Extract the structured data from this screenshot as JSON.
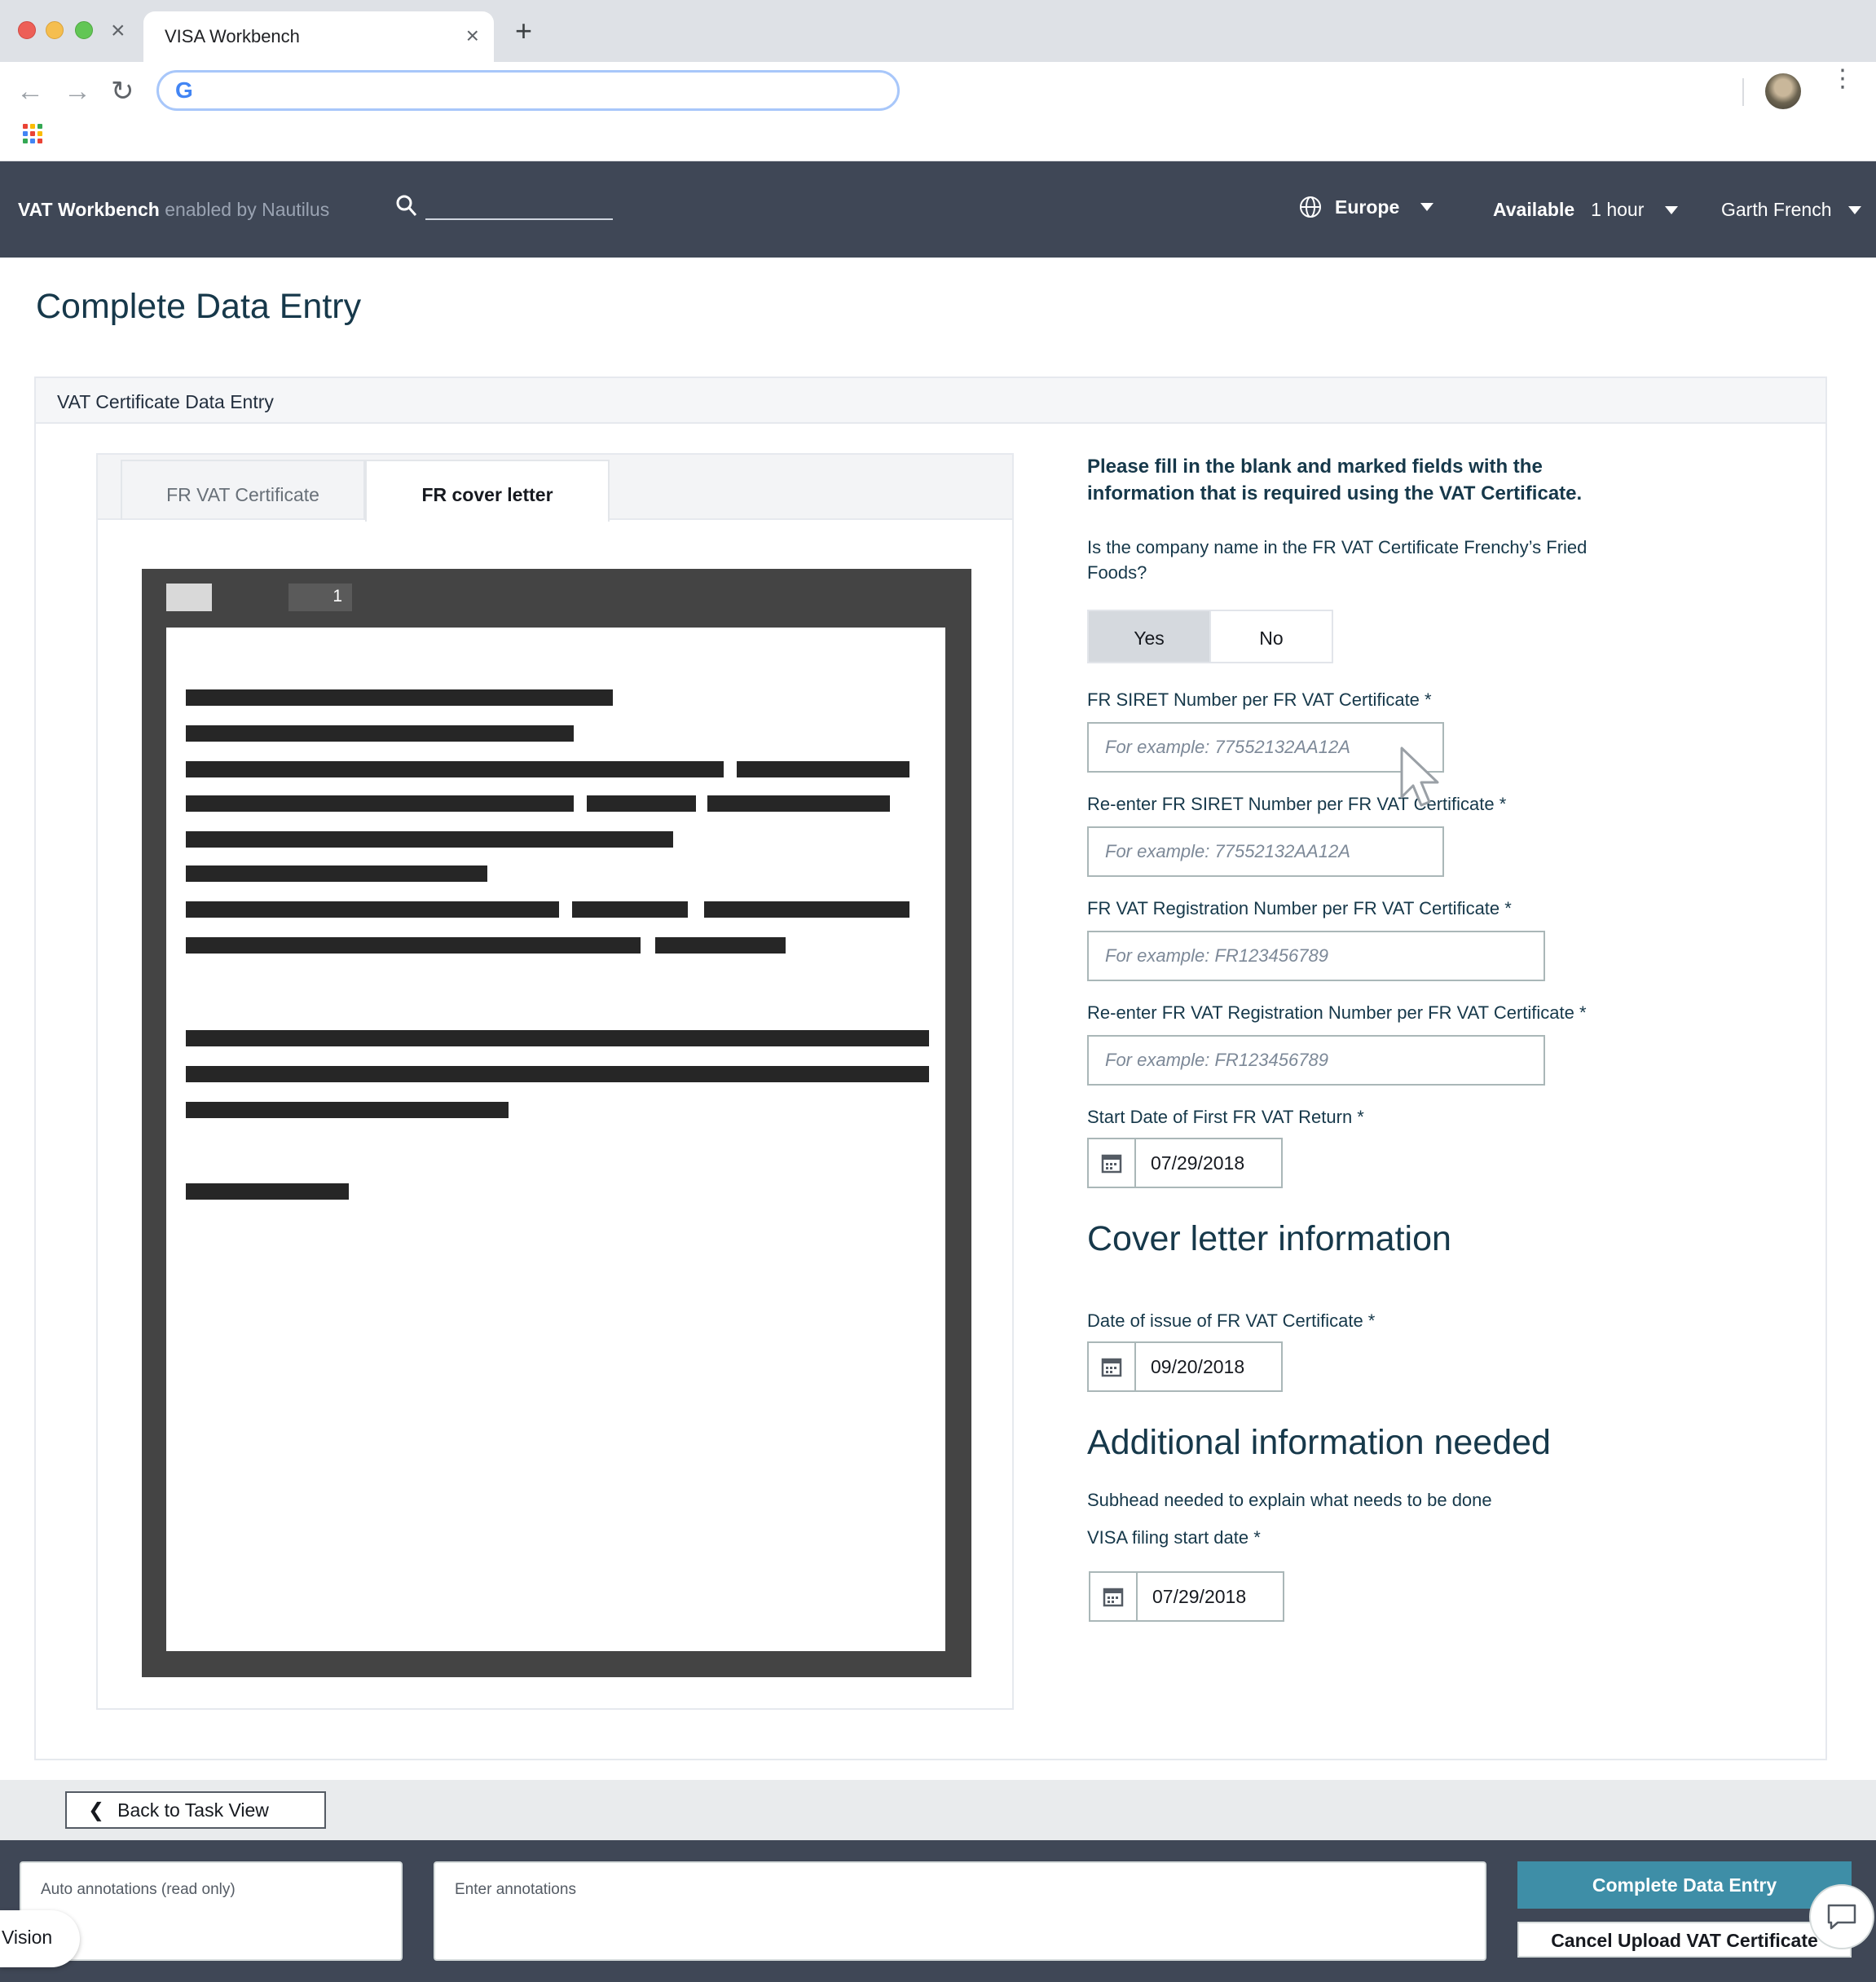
{
  "browser": {
    "tab_title": "VISA Workbench",
    "tab_close_glyph": "×",
    "new_tab_glyph": "+",
    "address_value": ""
  },
  "app": {
    "brand_name": "VAT Workbench",
    "brand_suffix": "enabled by Nautilus",
    "region": "Europe",
    "availability_label": "Available",
    "availability_value": "1 hour",
    "user_name": "Garth French"
  },
  "page": {
    "title": "Complete Data Entry",
    "panel_title": "VAT Certificate Data Entry"
  },
  "viewer": {
    "tabs": [
      {
        "label": "FR VAT Certificate",
        "selected": false
      },
      {
        "label": "FR cover letter",
        "selected": true
      }
    ],
    "page_number": "1"
  },
  "form": {
    "instructions": "Please fill in the blank and marked fields with the information that is required using the VAT Certificate.",
    "question": "Is the company name in the FR VAT Certificate Frenchy’s Fried Foods?",
    "yes_label": "Yes",
    "no_label": "No",
    "selected_answer": "Yes",
    "siret_label": "FR SIRET Number per FR VAT Certificate *",
    "siret_placeholder": "For example: 77552132AA12A",
    "siret_reenter_label": "Re-enter FR SIRET Number per FR VAT Certificate *",
    "siret_reenter_placeholder": "For example: 77552132AA12A",
    "vat_reg_label": "FR VAT Registration Number per FR VAT Certificate *",
    "vat_reg_placeholder": "For example: FR123456789",
    "vat_reg_reenter_label": "Re-enter FR VAT Registration Number per FR VAT Certificate *",
    "vat_reg_reenter_placeholder": "For example: FR123456789",
    "start_date_label": "Start Date of First FR VAT Return *",
    "start_date_value": "07/29/2018",
    "cover_letter_heading": "Cover letter information",
    "issue_date_label": "Date of issue of FR VAT Certificate *",
    "issue_date_value": "09/20/2018",
    "additional_heading": "Additional information needed",
    "additional_subhead": "Subhead needed to explain what needs to be done",
    "visa_date_label": "VISA filing start date *",
    "visa_date_value": "07/29/2018"
  },
  "footer": {
    "back_label": "Back to Task View",
    "auto_annotations_label": "Auto annotations (read only)",
    "enter_annotations_label": "Enter annotations",
    "vision_label": "Vision",
    "complete_button": "Complete Data Entry",
    "cancel_button": "Cancel Upload VAT Certificate"
  },
  "colors": {
    "header_bg": "#3f4756",
    "primary_button": "#3e8ea7",
    "heading_text": "#16384a",
    "selected_toggle": "#d5d9de"
  },
  "icons": [
    "back-arrow-icon",
    "forward-arrow-icon",
    "reload-icon",
    "google-icon",
    "apps-grid-icon",
    "more-vert-icon",
    "search-icon",
    "globe-icon",
    "caret-down-icon",
    "calendar-icon",
    "chevron-left-icon",
    "chat-icon",
    "cursor-pointer-icon"
  ]
}
